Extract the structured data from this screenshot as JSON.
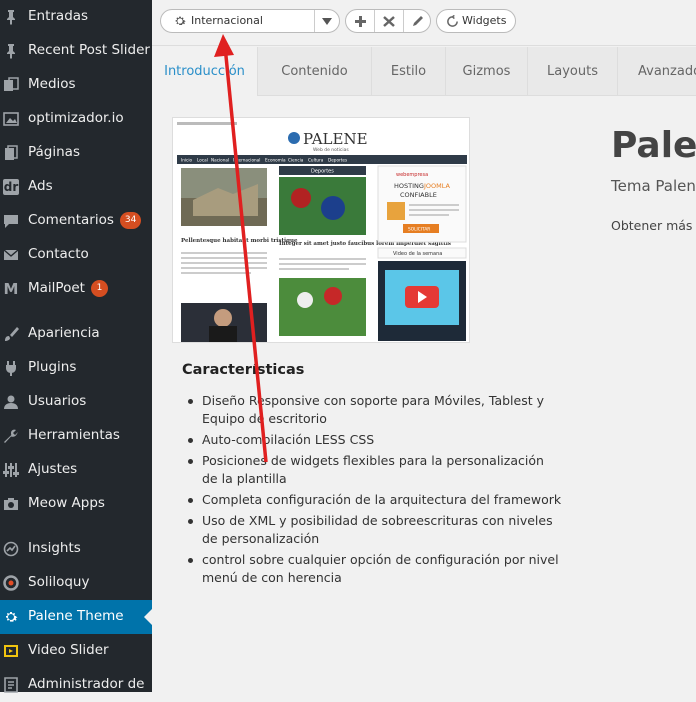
{
  "sidebar": {
    "items": [
      {
        "label": "Entradas",
        "icon": "pin-icon"
      },
      {
        "label": "Recent Post Slider",
        "icon": "pin-icon"
      },
      {
        "label": "Medios",
        "icon": "media-icon"
      },
      {
        "label": "optimizador.io",
        "icon": "images-icon"
      },
      {
        "label": "Páginas",
        "icon": "pages-icon"
      },
      {
        "label": "Ads",
        "icon": "dr-icon",
        "icon_text": "dr"
      },
      {
        "label": "Comentarios",
        "icon": "comment-icon",
        "badge": "34"
      },
      {
        "label": "Contacto",
        "icon": "mail-icon"
      },
      {
        "label": "MailPoet",
        "icon": "mailpoet-icon",
        "icon_text": "M",
        "badge": "1"
      },
      {
        "label": "Apariencia",
        "icon": "brush-icon"
      },
      {
        "label": "Plugins",
        "icon": "plugin-icon"
      },
      {
        "label": "Usuarios",
        "icon": "user-icon"
      },
      {
        "label": "Herramientas",
        "icon": "wrench-icon"
      },
      {
        "label": "Ajustes",
        "icon": "settings-icon"
      },
      {
        "label": "Meow Apps",
        "icon": "camera-icon"
      },
      {
        "label": "Insights",
        "icon": "insights-icon"
      },
      {
        "label": "Soliloquy",
        "icon": "soliloquy-icon"
      },
      {
        "label": "Palene Theme",
        "icon": "gear-icon",
        "current": true
      },
      {
        "label": "Video Slider",
        "icon": "video-icon"
      },
      {
        "label": "Administrador de",
        "icon": "admin-icon"
      }
    ]
  },
  "toolbar": {
    "style_select_value": "Internacional",
    "widgets_label": "Widgets"
  },
  "tabs": [
    "Introducción",
    "Contenido",
    "Estilo",
    "Gizmos",
    "Layouts",
    "Avanzado"
  ],
  "preview": {
    "logo": "PALENE",
    "tagline": "Web de noticias",
    "nav": [
      "Inicio",
      "Local",
      "Nacional",
      "Internacional",
      "Economía",
      "Ciencia",
      "Cultura",
      "Deportes"
    ],
    "col2_header": "Deportes",
    "col3_header": "Video de la semana",
    "ad_title1": "HOSTING",
    "ad_title2": "JOOMLA",
    "ad_title3": "CONFIABLE",
    "ad_brand": "webempresa",
    "ad_button": "SOLICITAR",
    "headline1": "Pellentesque habitant morbi tristique",
    "headline2": "Integer sit amet justo faucibus lorem imperdiet sagittis"
  },
  "features": {
    "title": "Características",
    "items": [
      "Diseño Responsive con soporte para Móviles, Tablest y Equipo de escritorio",
      "Auto-compilación LESS CSS",
      "Posiciones de widgets flexibles para la personalización de la plantilla",
      "Completa configuración de la arquitectura del framework",
      "Uso de XML y posibilidad de sobreescrituras con niveles de personalización",
      "control sobre cualquier opción de configuración por nivel menú de con herencia"
    ]
  },
  "theme_info": {
    "name": "Palene",
    "subtitle": "Tema Palene",
    "more": "Obtener más información"
  },
  "colors": {
    "sidebar_bg": "#23282d",
    "current_bg": "#0073aa",
    "tab_active": "#2a8fc9",
    "arrow": "#e02020"
  }
}
